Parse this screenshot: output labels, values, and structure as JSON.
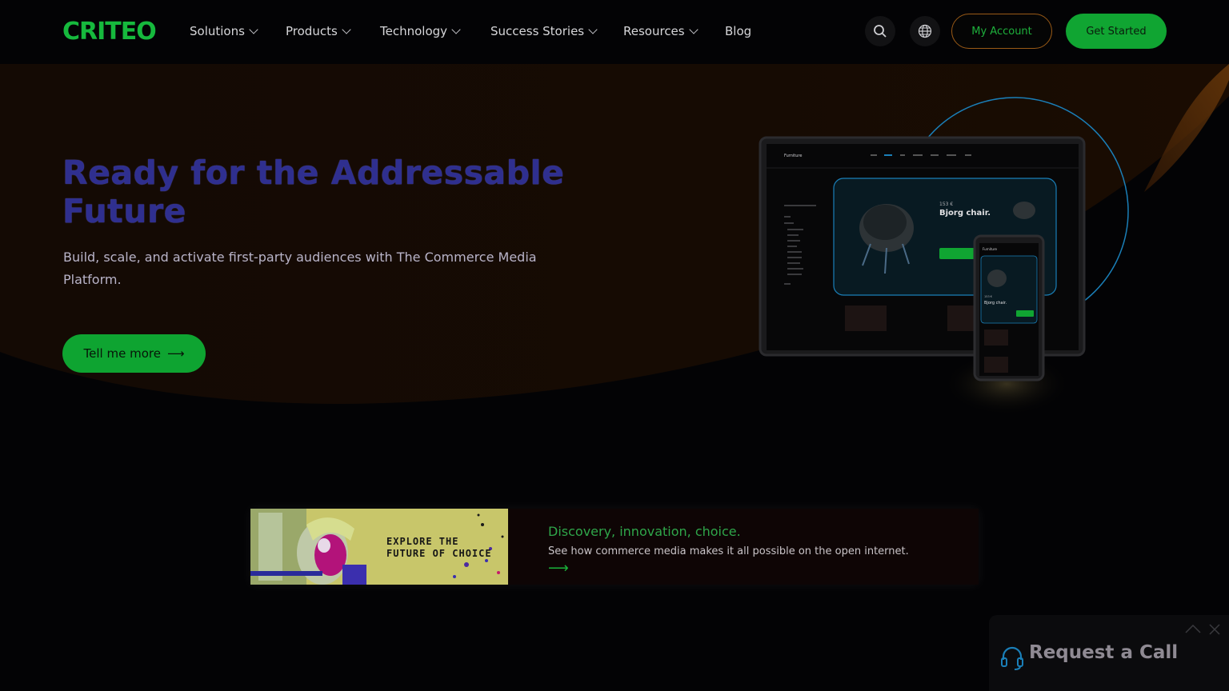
{
  "brand": {
    "logo_text": "CRITEO",
    "accent": "#16b93d",
    "orange": "#a05a10"
  },
  "nav": {
    "items": [
      {
        "label": "Solutions",
        "has_dropdown": true
      },
      {
        "label": "Products",
        "has_dropdown": true
      },
      {
        "label": "Technology",
        "has_dropdown": true
      },
      {
        "label": "Success Stories",
        "has_dropdown": true
      },
      {
        "label": "Resources",
        "has_dropdown": true
      },
      {
        "label": "Blog",
        "has_dropdown": false
      }
    ],
    "search_icon": "search-icon",
    "language_icon": "globe-icon",
    "account_label": "My Account",
    "get_started_label": "Get Started"
  },
  "hero": {
    "title": "Ready for the Addressable Future",
    "subtitle": "Build, scale, and activate first-party audiences with The Commerce Media Platform.",
    "cta_label": "Tell me more",
    "cta_arrow": "⟶"
  },
  "mock": {
    "site_title": "Furniture",
    "price": "153 €",
    "product_name": "Bjorg chair.",
    "mobile_title": "Furniture",
    "mobile_price": "153 €",
    "mobile_product": "Bjorg chair."
  },
  "banner": {
    "image_text_line1": "EXPLORE THE",
    "image_text_line2": "FUTURE OF CHOICE",
    "title": "Discovery, innovation, choice.",
    "subtitle": "See how commerce media makes it all possible on the open internet.",
    "arrow": "⟶"
  },
  "call_widget": {
    "label": "Request a Call",
    "icon": "headset-icon",
    "collapse_icon": "chevron-up-icon",
    "close_icon": "close-icon"
  }
}
